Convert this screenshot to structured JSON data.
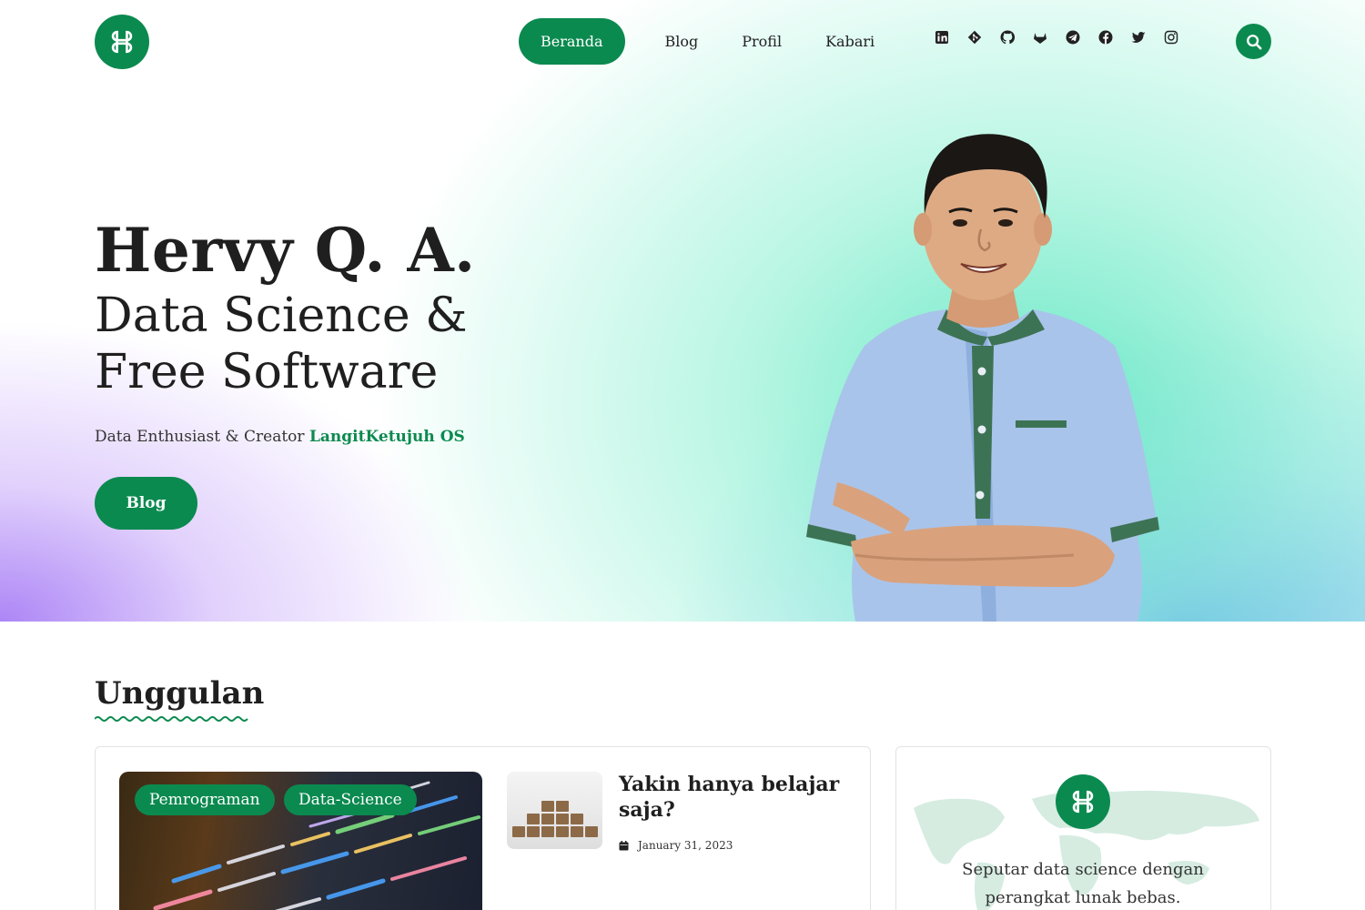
{
  "nav": {
    "items": [
      {
        "label": "Beranda",
        "active": true
      },
      {
        "label": "Blog",
        "active": false
      },
      {
        "label": "Profil",
        "active": false
      },
      {
        "label": "Kabari",
        "active": false
      }
    ],
    "socials": [
      "linkedin-icon",
      "git-icon",
      "github-icon",
      "gitlab-icon",
      "telegram-icon",
      "facebook-icon",
      "twitter-icon",
      "instagram-icon"
    ],
    "search_icon": "search-icon"
  },
  "hero": {
    "name": "Hervy Q. A.",
    "tagline": "Data Science & Free Software",
    "subtitle_prefix": "Data Enthusiast & Creator ",
    "subtitle_accent": "LangitKetujuh OS",
    "cta_label": "Blog"
  },
  "featured": {
    "title": "Unggulan",
    "tags": [
      "Pemrograman",
      "Data-Science"
    ],
    "post": {
      "title": "Yakin hanya belajar saja?",
      "date": "January 31, 2023"
    },
    "about_text": "Seputar data science dengan perangkat lunak bebas."
  },
  "colors": {
    "accent": "#0b8a4f",
    "gradient_purple": "#a87ff5",
    "gradient_green": "#66e8c4",
    "gradient_blue": "#5ca0f5"
  }
}
